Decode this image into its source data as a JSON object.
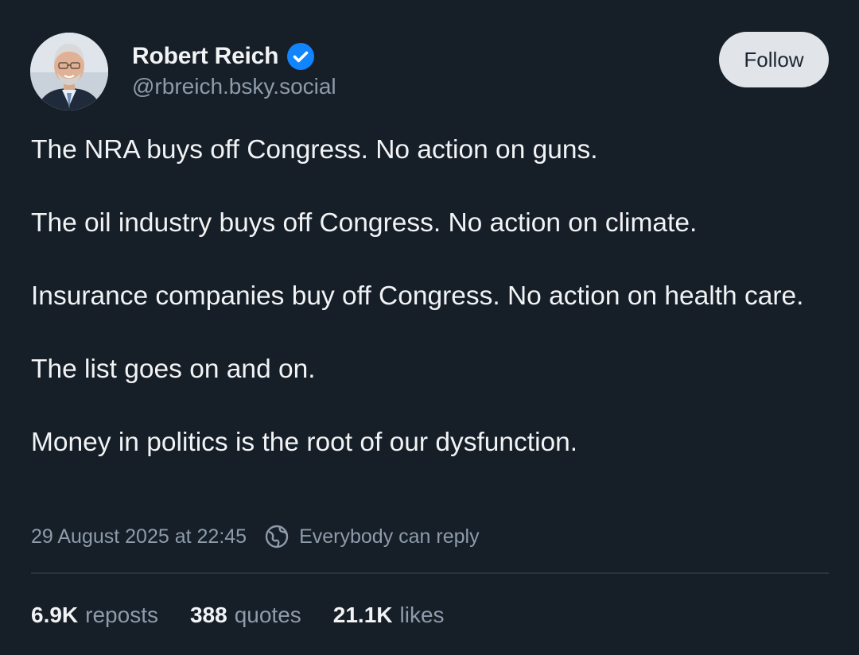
{
  "author": {
    "display_name": "Robert Reich",
    "handle": "@rbreich.bsky.social",
    "verified": true
  },
  "actions": {
    "follow_label": "Follow"
  },
  "post": {
    "paragraphs": [
      "The NRA buys off Congress. No action on guns.",
      "The oil industry buys off Congress. No action on climate.",
      "Insurance companies buy off Congress. No action on health care.",
      "The list goes on and on.",
      "Money in politics is the root of our dysfunction."
    ],
    "timestamp": "29 August 2025 at 22:45",
    "reply_setting": "Everybody can reply",
    "reply_setting_icon": "globe-icon"
  },
  "stats": {
    "reposts": {
      "count": "6.9K",
      "label": "reposts"
    },
    "quotes": {
      "count": "388",
      "label": "quotes"
    },
    "likes": {
      "count": "21.1K",
      "label": "likes"
    }
  },
  "colors": {
    "background": "#161e27",
    "text_primary": "#f1f3f5",
    "text_secondary": "#8d9bab",
    "verified_badge": "#1185fe",
    "follow_button_bg": "#e1e5e9"
  }
}
